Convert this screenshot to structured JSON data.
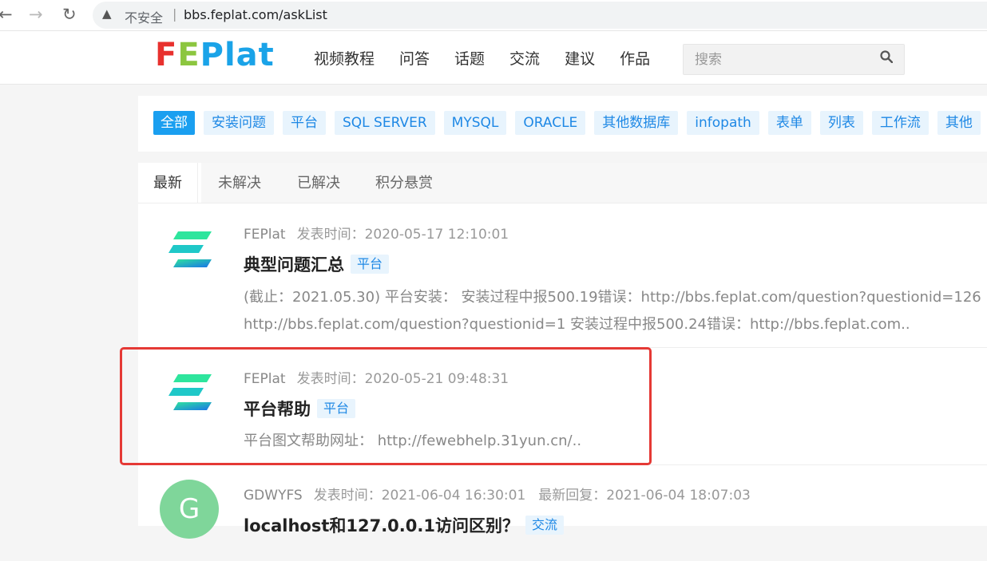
{
  "browser": {
    "insecure_label": "不安全",
    "separator": "|",
    "url": "bbs.feplat.com/askList"
  },
  "header": {
    "logo_parts": [
      "F",
      "E",
      "Plat"
    ],
    "menu": [
      "视频教程",
      "问答",
      "话题",
      "交流",
      "建议",
      "作品"
    ],
    "search_placeholder": "搜索"
  },
  "categories": [
    "全部",
    "安装问题",
    "平台",
    "SQL SERVER",
    "MYSQL",
    "ORACLE",
    "其他数据库",
    "infopath",
    "表单",
    "列表",
    "工作流",
    "其他"
  ],
  "tabs": [
    "最新",
    "未解决",
    "已解决",
    "积分悬赏"
  ],
  "questions": [
    {
      "author": "FEPlat",
      "posted": "发表时间：2020-05-17 12:10:01",
      "title": "典型问题汇总",
      "tag": "平台",
      "excerpt_line1": "(截止：2021.05.30) 平台安装： 安装过程中报500.19错误：http://bbs.feplat.com/question?questionid=126",
      "excerpt_line2": "http://bbs.feplat.com/question?questionid=1 安装过程中报500.24错误：http://bbs.feplat.com.."
    },
    {
      "author": "FEPlat",
      "posted": "发表时间：2020-05-21 09:48:31",
      "title": "平台帮助",
      "tag": "平台",
      "excerpt_line1": "平台图文帮助网址： http://fewebhelp.31yun.cn/.."
    },
    {
      "author": "GDWYFS",
      "avatar_letter": "G",
      "posted": "发表时间：2021-06-04 16:30:01",
      "last_reply": "最新回复：2021-06-04 18:07:03",
      "title": "localhost和127.0.0.1访问区别？",
      "tag": "交流"
    }
  ]
}
